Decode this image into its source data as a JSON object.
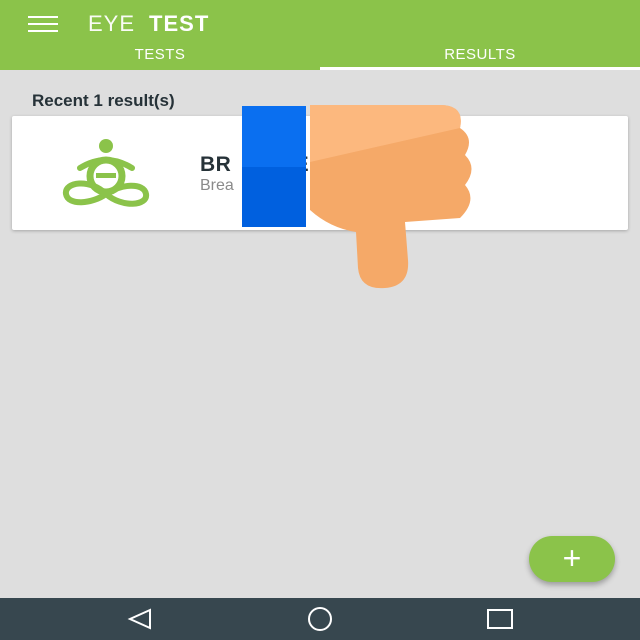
{
  "colors": {
    "primary": "#8bc34a",
    "nav_bar": "#37474f",
    "background": "#dedede",
    "overlay_blue": "#0a6ff0",
    "overlay_skin": "#f5a968"
  },
  "app_bar": {
    "menu_icon": "hamburger-menu-icon",
    "title_light": "EYE",
    "title_bold": "TEST"
  },
  "tabs": [
    {
      "label": "TESTS",
      "selected": false
    },
    {
      "label": "RESULTS",
      "selected": true
    }
  ],
  "results": {
    "heading": "Recent 1 result(s)",
    "items": [
      {
        "logo_icon": "meditation-logo-icon",
        "title": "BR          ENESS",
        "subtitle": "Brea                      day"
      }
    ]
  },
  "overlays": {
    "blue_bar": "blue-rectangle",
    "hand_icon": "thumbs-down-icon"
  },
  "fab": {
    "label": "+",
    "icon": "add-icon"
  },
  "nav_bar": {
    "back_icon": "back-triangle-icon",
    "home_icon": "home-circle-icon",
    "recents_icon": "recents-square-icon"
  }
}
